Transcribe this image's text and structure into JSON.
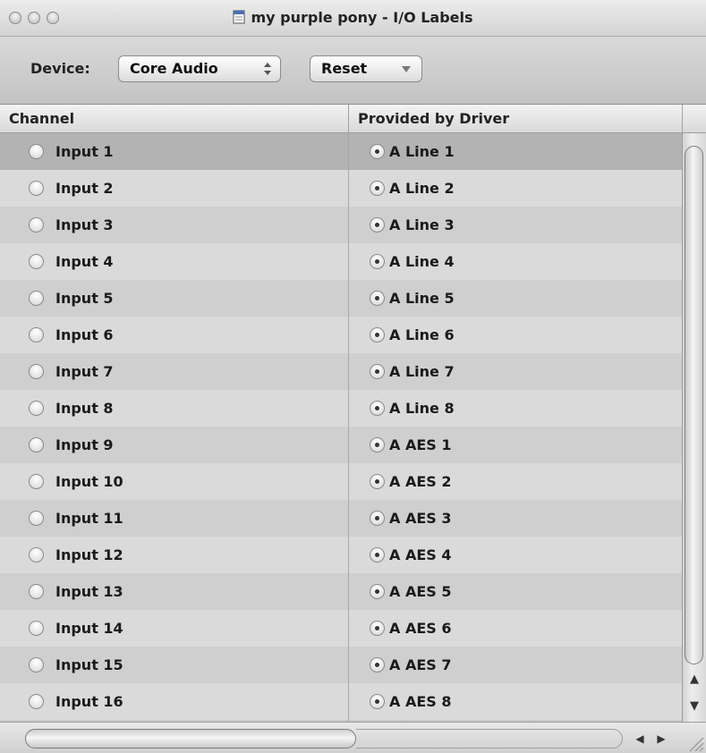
{
  "window": {
    "title": "my purple pony - I/O Labels"
  },
  "toolbar": {
    "device_label": "Device:",
    "device_value": "Core Audio",
    "reset_label": "Reset"
  },
  "table": {
    "columns": [
      "Channel",
      "Provided by Driver"
    ],
    "rows": [
      {
        "channel": "Input 1",
        "driver": "A Line 1"
      },
      {
        "channel": "Input 2",
        "driver": "A Line 2"
      },
      {
        "channel": "Input 3",
        "driver": "A Line 3"
      },
      {
        "channel": "Input 4",
        "driver": "A Line 4"
      },
      {
        "channel": "Input 5",
        "driver": "A Line 5"
      },
      {
        "channel": "Input 6",
        "driver": "A Line 6"
      },
      {
        "channel": "Input 7",
        "driver": "A Line 7"
      },
      {
        "channel": "Input 8",
        "driver": "A Line 8"
      },
      {
        "channel": "Input 9",
        "driver": "A AES 1"
      },
      {
        "channel": "Input 10",
        "driver": "A AES 2"
      },
      {
        "channel": "Input 11",
        "driver": "A AES 3"
      },
      {
        "channel": "Input 12",
        "driver": "A AES 4"
      },
      {
        "channel": "Input 13",
        "driver": "A AES 5"
      },
      {
        "channel": "Input 14",
        "driver": "A AES 6"
      },
      {
        "channel": "Input 15",
        "driver": "A AES 7"
      },
      {
        "channel": "Input 16",
        "driver": "A AES 8"
      }
    ]
  }
}
